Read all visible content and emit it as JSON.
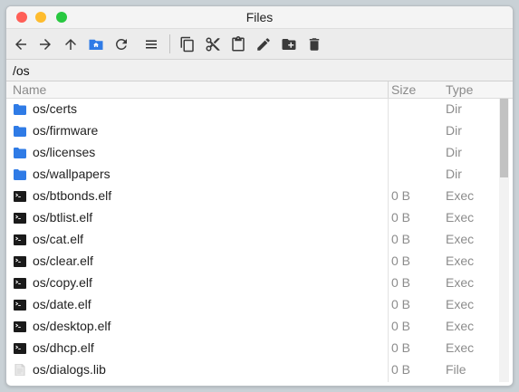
{
  "window": {
    "title": "Files"
  },
  "toolbar": {
    "buttons": [
      {
        "id": "back",
        "icon": "arrow-left-icon"
      },
      {
        "id": "forward",
        "icon": "arrow-right-icon"
      },
      {
        "id": "up",
        "icon": "arrow-up-icon"
      },
      {
        "id": "home",
        "icon": "home-folder-icon"
      },
      {
        "id": "refresh",
        "icon": "refresh-icon"
      },
      {
        "id": "view",
        "icon": "list-view-icon"
      },
      {
        "id": "copy",
        "icon": "copy-icon"
      },
      {
        "id": "cut",
        "icon": "scissors-icon"
      },
      {
        "id": "paste",
        "icon": "clipboard-icon"
      },
      {
        "id": "rename",
        "icon": "pencil-icon"
      },
      {
        "id": "new_folder",
        "icon": "new-folder-icon"
      },
      {
        "id": "delete",
        "icon": "trash-icon"
      }
    ]
  },
  "path": {
    "value": "/os"
  },
  "columns": {
    "name": "Name",
    "size": "Size",
    "type": "Type"
  },
  "files": [
    {
      "name": "os/certs",
      "size": "",
      "type": "Dir",
      "kind": "folder"
    },
    {
      "name": "os/firmware",
      "size": "",
      "type": "Dir",
      "kind": "folder"
    },
    {
      "name": "os/licenses",
      "size": "",
      "type": "Dir",
      "kind": "folder"
    },
    {
      "name": "os/wallpapers",
      "size": "",
      "type": "Dir",
      "kind": "folder"
    },
    {
      "name": "os/btbonds.elf",
      "size": "0 B",
      "type": "Exec",
      "kind": "exec"
    },
    {
      "name": "os/btlist.elf",
      "size": "0 B",
      "type": "Exec",
      "kind": "exec"
    },
    {
      "name": "os/cat.elf",
      "size": "0 B",
      "type": "Exec",
      "kind": "exec"
    },
    {
      "name": "os/clear.elf",
      "size": "0 B",
      "type": "Exec",
      "kind": "exec"
    },
    {
      "name": "os/copy.elf",
      "size": "0 B",
      "type": "Exec",
      "kind": "exec"
    },
    {
      "name": "os/date.elf",
      "size": "0 B",
      "type": "Exec",
      "kind": "exec"
    },
    {
      "name": "os/desktop.elf",
      "size": "0 B",
      "type": "Exec",
      "kind": "exec"
    },
    {
      "name": "os/dhcp.elf",
      "size": "0 B",
      "type": "Exec",
      "kind": "exec"
    },
    {
      "name": "os/dialogs.lib",
      "size": "0 B",
      "type": "File",
      "kind": "file"
    }
  ],
  "colors": {
    "accent": "#2f7be6",
    "folder": "#2f7be6",
    "exec": "#1a1a1a",
    "file": "#d0d0d0"
  }
}
